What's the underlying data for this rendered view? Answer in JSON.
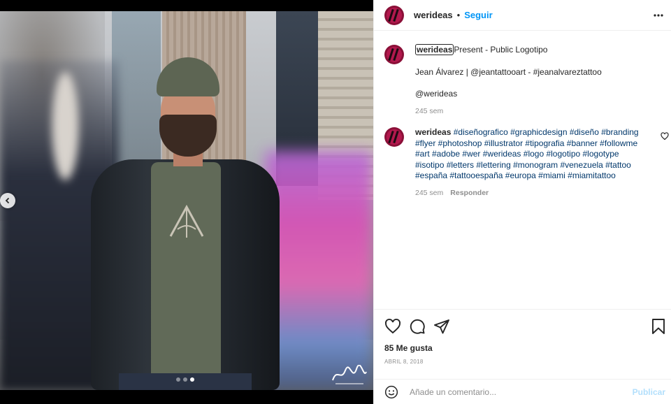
{
  "post": {
    "username": "werideas",
    "separator": "•",
    "follow_label": "Seguir"
  },
  "caption": {
    "username": "werideas",
    "title": "Present - Public Logotipo",
    "credit": "Jean Álvarez | @jeantattooart - #jeanalvareztattoo",
    "mention": "@werideas",
    "time": "245 sem"
  },
  "comment": {
    "username": "werideas",
    "hashtags_1": "#diseñografico #graphicdesign #diseño #branding",
    "hashtags_2": "#flyer #photoshop #illustrator #tipografia #banner #followme",
    "hashtags_3": "#art #adobe #wer #werideas #logo #logotipo #logotype",
    "hashtags_4": "#isotipo #letters #lettering #monogram #venezuela #tattoo",
    "hashtags_5": "#españa #tattooespaña #europa #miami #miamitattoo",
    "time": "245 sem",
    "reply_label": "Responder"
  },
  "stats": {
    "likes": "85 Me gusta",
    "date": "ABRIL 8, 2018"
  },
  "add_comment": {
    "placeholder": "Añade un comentario...",
    "publish_label": "Publicar"
  },
  "carousel": {
    "total": 3,
    "active": 3
  },
  "colors": {
    "accent": "#0095f6",
    "publish_disabled": "#b2dffc",
    "hashtag": "#00376b",
    "muted": "#8e8e8e",
    "text": "#262626"
  },
  "icons": [
    "chevron-left-icon",
    "more-icon",
    "heart-icon",
    "comment-icon",
    "share-icon",
    "bookmark-icon",
    "emoji-icon"
  ]
}
